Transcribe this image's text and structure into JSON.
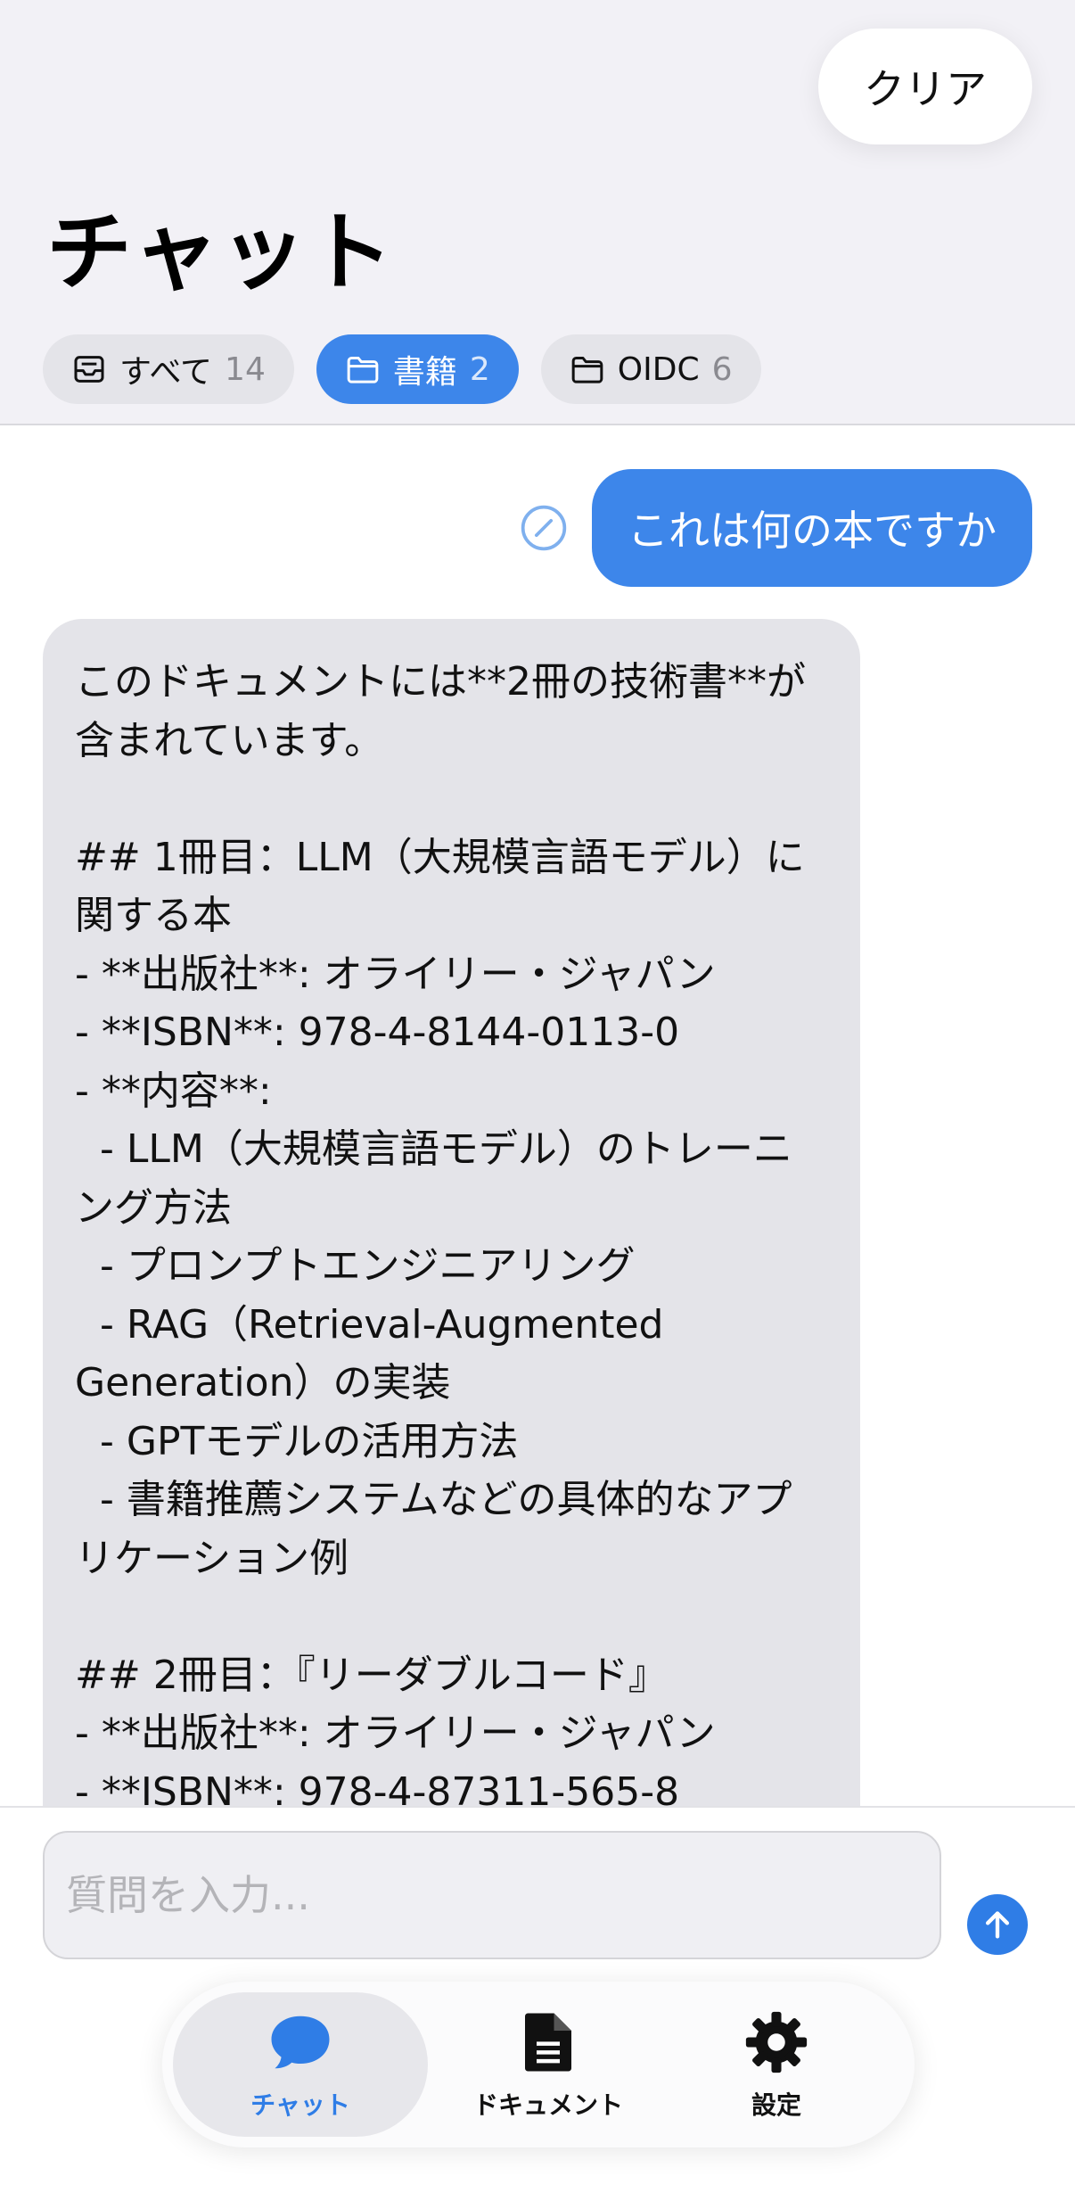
{
  "header": {
    "clear_label": "クリア",
    "title": "チャット",
    "filters": [
      {
        "label": "すべて",
        "count": "14"
      },
      {
        "label": "書籍",
        "count": "2"
      },
      {
        "label": "OIDC",
        "count": "6"
      }
    ]
  },
  "conversation": {
    "user_message": "これは何の本ですか",
    "assistant_message": "このドキュメントには**2冊の技術書**が含まれています。\n\n## 1冊目：LLM（大規模言語モデル）に関する本\n- **出版社**: オライリー・ジャパン\n- **ISBN**: 978-4-8144-0113-0\n- **内容**:\n  - LLM（大規模言語モデル）のトレーニング方法\n  - プロンプトエンジニアリング\n  - RAG（Retrieval-Augmented Generation）の実装\n  - GPTモデルの活用方法\n  - 書籍推薦システムなどの具体的なアプリケーション例\n\n## 2冊目：『リーダブルコード』\n- **出版社**: オライリー・ジャパン\n- **ISBN**: 978-4-87311-565-8"
  },
  "input": {
    "placeholder": "質問を入力..."
  },
  "tabs": [
    {
      "label": "チャット",
      "icon": "chat-bubble-icon",
      "active": true
    },
    {
      "label": "ドキュメント",
      "icon": "document-icon",
      "active": false
    },
    {
      "label": "設定",
      "icon": "gear-icon",
      "active": false
    }
  ],
  "colors": {
    "accent": "#3d86ea",
    "header_bg": "#f2f1f6",
    "bubble_gray": "#e4e4e9"
  }
}
